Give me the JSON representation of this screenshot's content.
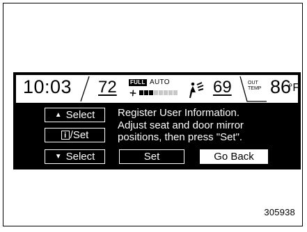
{
  "status_bar": {
    "time": "10:03",
    "temp_left": "72",
    "fan_mode_badge": "FULL",
    "auto_label": "AUTO",
    "fan_level": 3,
    "fan_level_max": 8,
    "temp_right": "69",
    "out_label_line1": "OUT",
    "out_label_line2": "TEMP",
    "outside_temp": "86",
    "outside_temp_unit": "°F",
    "icons": [
      "fan-icon",
      "airflow-mode-icon"
    ]
  },
  "left_buttons": {
    "select_up": "Select",
    "info_glyph": "i",
    "info_set": "/Set",
    "select_down": "Select"
  },
  "message": {
    "line1": "Register User Information.",
    "line2": "Adjust seat and door mirror",
    "line3": "positions, then press \"Set\"."
  },
  "actions": {
    "set": "Set",
    "go_back": "Go Back"
  },
  "figure_number": "305938",
  "colors": {
    "display_bg": "#000000",
    "display_fg": "#ffffff",
    "status_bar_bg": "#ffffff"
  }
}
